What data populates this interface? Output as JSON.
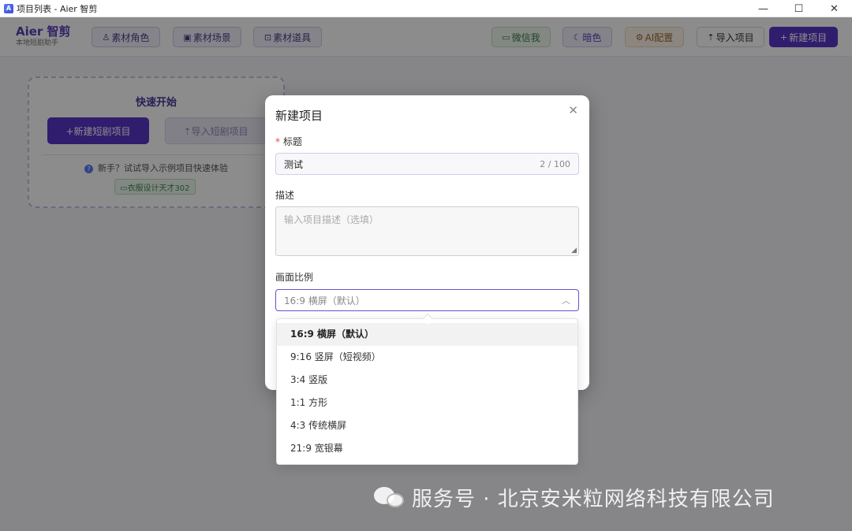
{
  "window": {
    "title": "项目列表 - Aier 智剪",
    "controls": {
      "minimize": "—",
      "maximize": "☐",
      "close": "✕"
    }
  },
  "header": {
    "brand_name": "Aier 智剪",
    "brand_sub": "本地短剧助手",
    "buttons": [
      {
        "icon": "♙",
        "label": "素材角色"
      },
      {
        "icon": "▣",
        "label": "素材场景"
      },
      {
        "icon": "⊡",
        "label": "素材道具"
      },
      {
        "icon": "▭",
        "label": "微信我"
      },
      {
        "icon": "☾",
        "label": "暗色"
      },
      {
        "icon": "⚙",
        "label": "AI配置"
      },
      {
        "icon": "⇡",
        "label": "导入项目"
      },
      {
        "icon": "+",
        "label": "新建项目"
      }
    ]
  },
  "quick_start": {
    "title": "快速开始",
    "new_label": "+新建短剧项目",
    "import_label": "⇡导入短剧项目",
    "hint": "新手？试试导入示例项目快速体验",
    "sample_tag": "▭衣服设计天才302"
  },
  "modal": {
    "title": "新建项目",
    "close_icon": "✕",
    "title_field": {
      "label": "标题",
      "required_mark": "*",
      "value": "测试",
      "count": "2 / 100"
    },
    "desc_field": {
      "label": "描述",
      "placeholder": "输入项目描述（选填）"
    },
    "ratio_field": {
      "label": "画面比例",
      "selected": "16:9 横屏（默认）",
      "chevron": "︿"
    }
  },
  "dropdown": {
    "options": [
      "16:9 横屏（默认）",
      "9:16 竖屏（短视频）",
      "3:4 竖版",
      "1:1 方形",
      "4:3 传统横屏",
      "21:9 宽银幕"
    ],
    "selected_index": 0
  },
  "watermark": {
    "text": "服务号 · 北京安米粒网络科技有限公司"
  },
  "colors": {
    "accent": "#5a35c9",
    "overlay": "rgba(0,0,0,0.45)",
    "required": "#e5484d"
  }
}
